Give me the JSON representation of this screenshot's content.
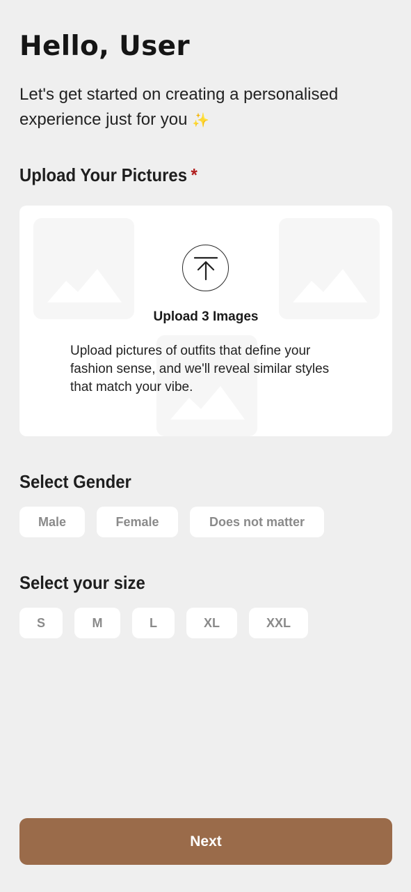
{
  "header": {
    "greeting": "Hello, User",
    "subtitle": "Let's get started on creating a personalised experience just for you",
    "sparkle": "✨"
  },
  "upload": {
    "section_title": "Upload Your Pictures",
    "required_mark": "*",
    "button_title": "Upload 3 Images",
    "description": "Upload pictures of outfits that define your fashion sense, and we'll reveal similar styles that match your vibe.",
    "icon": "upload-arrow-icon",
    "placeholder_icon": "image-placeholder-icon"
  },
  "gender": {
    "section_title": "Select Gender",
    "options": [
      "Male",
      "Female",
      "Does not matter"
    ]
  },
  "size": {
    "section_title": "Select your size",
    "options": [
      "S",
      "M",
      "L",
      "XL",
      "XXL"
    ]
  },
  "footer": {
    "next_label": "Next"
  },
  "colors": {
    "background": "#efefef",
    "card": "#ffffff",
    "accent": "#9a6b4a",
    "required": "#b01e1e",
    "chip_text": "#8a8a8a"
  }
}
